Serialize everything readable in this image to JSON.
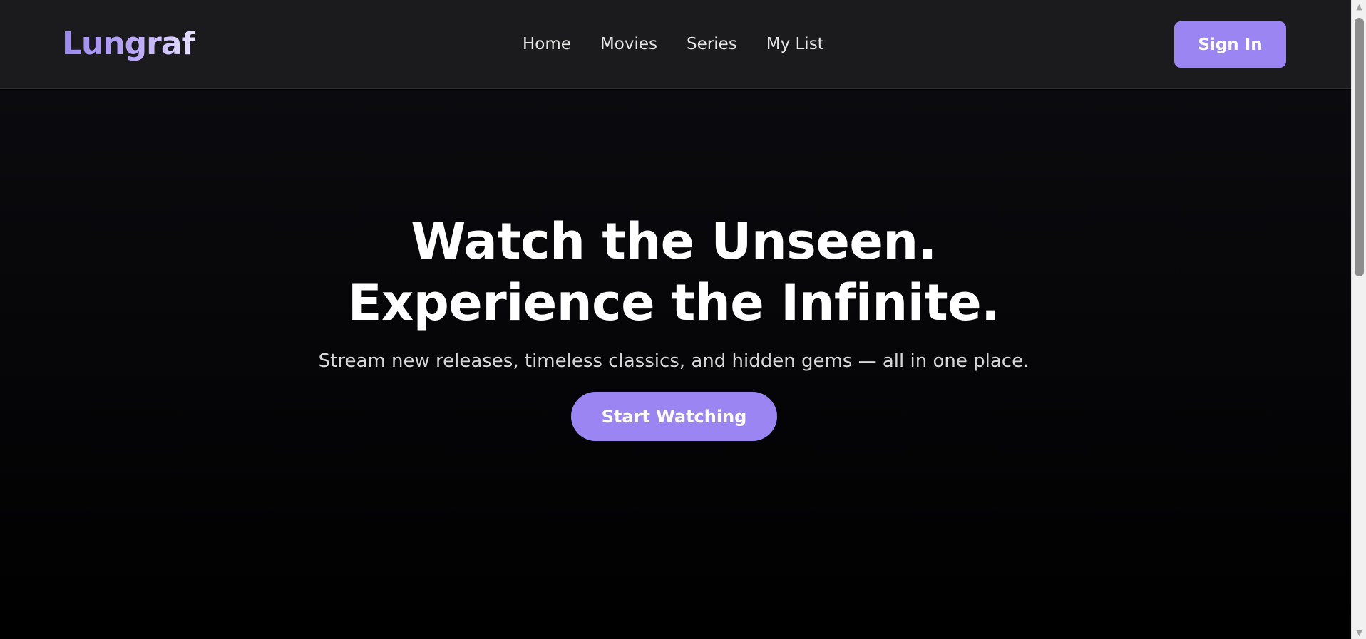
{
  "header": {
    "logo": "Lungraf",
    "nav": [
      "Home",
      "Movies",
      "Series",
      "My List"
    ],
    "signin_label": "Sign In"
  },
  "hero": {
    "title_line1": "Watch the Unseen.",
    "title_line2": "Experience the Infinite.",
    "subtitle": "Stream new releases, timeless classics, and hidden gems — all in one place.",
    "cta_label": "Start Watching"
  },
  "scrollbar": {
    "up_icon": "scroll-up-arrow-icon",
    "down_icon": "scroll-down-arrow-icon"
  },
  "colors": {
    "accent": "#9b85f3",
    "header_bg": "#1b1b1d",
    "page_bg": "#000000",
    "text_primary": "#ffffff",
    "text_secondary": "#d7d7d7"
  }
}
